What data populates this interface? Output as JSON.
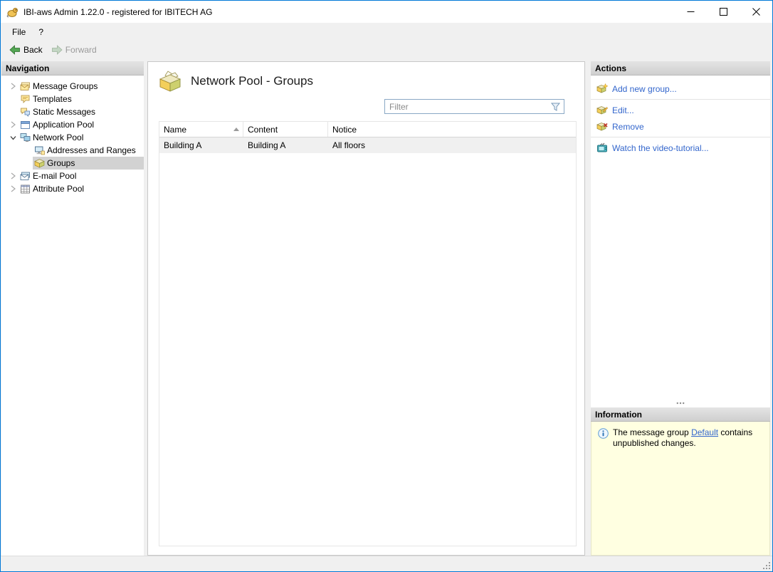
{
  "window": {
    "title": "IBI-aws Admin 1.22.0 - registered for IBITECH AG"
  },
  "menu": {
    "file": "File",
    "help": "?"
  },
  "toolbar": {
    "back": "Back",
    "forward": "Forward"
  },
  "navigation": {
    "header": "Navigation",
    "items": [
      {
        "label": "Message Groups",
        "state": "collapsed",
        "level": 0
      },
      {
        "label": "Templates",
        "state": "leaf",
        "level": 0
      },
      {
        "label": "Static Messages",
        "state": "leaf",
        "level": 0
      },
      {
        "label": "Application Pool",
        "state": "collapsed",
        "level": 0
      },
      {
        "label": "Network Pool",
        "state": "expanded",
        "level": 0
      },
      {
        "label": "Addresses and Ranges",
        "state": "leaf",
        "level": 1
      },
      {
        "label": "Groups",
        "state": "leaf",
        "level": 1,
        "selected": true
      },
      {
        "label": "E-mail Pool",
        "state": "collapsed",
        "level": 0
      },
      {
        "label": "Attribute Pool",
        "state": "collapsed",
        "level": 0
      }
    ]
  },
  "main": {
    "title": "Network Pool - Groups",
    "filter": {
      "placeholder": "Filter"
    },
    "table": {
      "columns": [
        "Name",
        "Content",
        "Notice"
      ],
      "sort_column": "Name",
      "sort_direction": "ascending",
      "rows": [
        {
          "name": "Building A",
          "content": "Building A",
          "notice": "All floors"
        }
      ]
    }
  },
  "actions": {
    "header": "Actions",
    "add": "Add new group...",
    "edit": "Edit...",
    "remove": "Remove",
    "tutorial": "Watch the video-tutorial..."
  },
  "information": {
    "header": "Information",
    "message_before": "The message group ",
    "message_link": "Default",
    "message_after": " contains unpublished changes."
  },
  "colors": {
    "window_border": "#0078d7",
    "link": "#3366cc",
    "info_background": "#ffffe1",
    "selection": "#d2d2d2"
  }
}
